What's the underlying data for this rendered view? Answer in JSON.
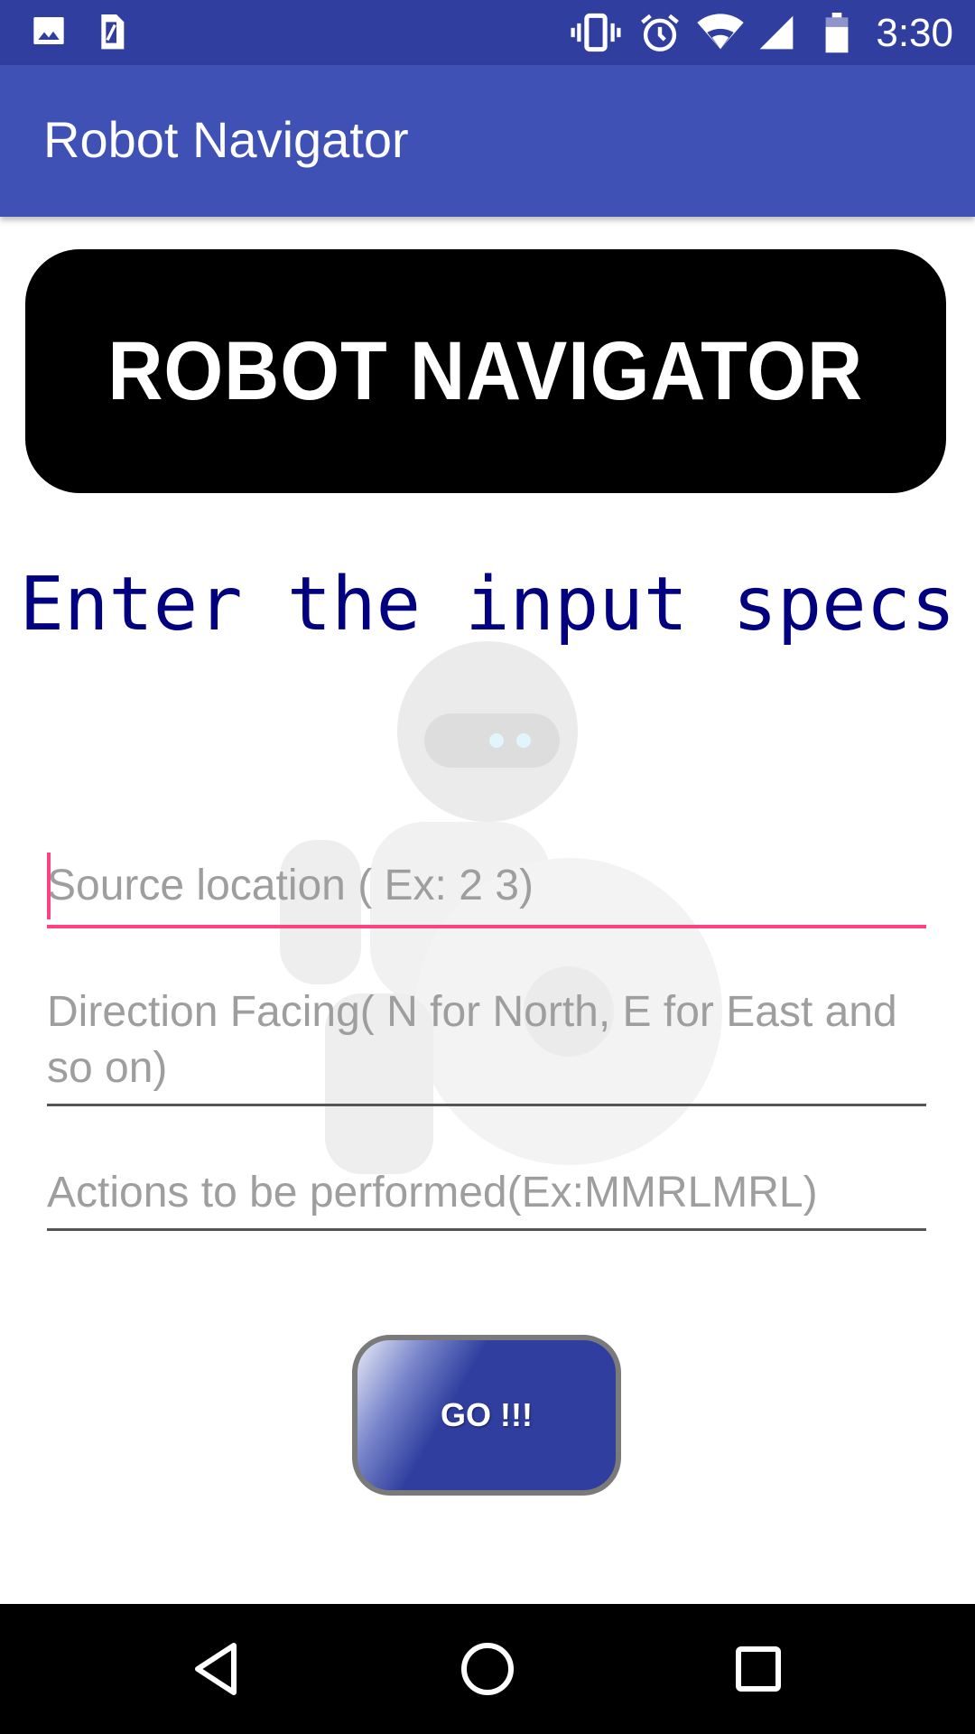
{
  "status_bar": {
    "time": "3:30",
    "icons": [
      "image-icon",
      "sim-card-icon",
      "vibrate-icon",
      "alarm-icon",
      "wifi-icon",
      "signal-icon",
      "battery-icon"
    ],
    "background": "#303f9f"
  },
  "app_bar": {
    "title": "Robot Navigator",
    "background": "#3f51b5"
  },
  "banner": {
    "text": "ROBOT NAVIGATOR"
  },
  "heading": {
    "text": "Enter the input specs",
    "color": "#000080"
  },
  "form": {
    "source_placeholder": "Source location ( Ex: 2 3)",
    "direction_placeholder": "Direction Facing( N for North, E for East and so on)",
    "actions_placeholder": "Actions to be performed(Ex:MMRLMRL)",
    "accent_color": "#ff4081"
  },
  "go_button": {
    "label": "GO !!!"
  },
  "nav_bar": {
    "icons": [
      "back-icon",
      "home-icon",
      "recents-icon"
    ]
  }
}
